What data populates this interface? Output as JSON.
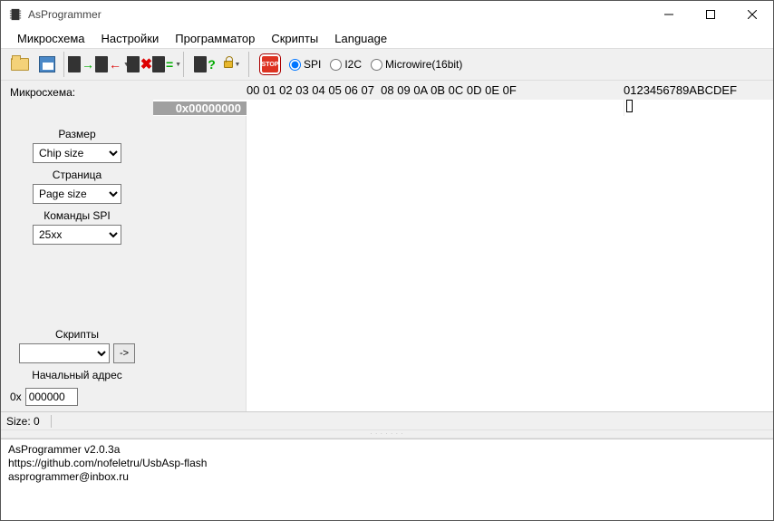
{
  "window": {
    "title": "AsProgrammer"
  },
  "menu": {
    "items": [
      "Микросхема",
      "Настройки",
      "Программатор",
      "Скрипты",
      "Language"
    ]
  },
  "toolbar": {
    "radios": {
      "spi": "SPI",
      "i2c": "I2C",
      "microwire": "Microwire(16bit)",
      "selected": "spi"
    },
    "stop_label": "STOP"
  },
  "sidebar": {
    "title": "Микросхема:",
    "size_label": "Размер",
    "size_value": "Chip size",
    "page_label": "Страница",
    "page_value": "Page size",
    "spi_label": "Команды SPI",
    "spi_value": "25xx",
    "scripts_label": "Скрипты",
    "scripts_value": "",
    "run_label": "->",
    "startaddr_label": "Начальный адрес",
    "startaddr_prefix": "0x",
    "startaddr_value": "000000"
  },
  "hex": {
    "header_cols": "00 01 02 03 04 05 06 07  08 09 0A 0B 0C 0D 0E 0F",
    "header_ascii": "0123456789ABCDEF",
    "row0_addr": "0x00000000"
  },
  "status": {
    "size_label": "Size: 0"
  },
  "console": {
    "lines": [
      "AsProgrammer v2.0.3a",
      "https://github.com/nofeletru/UsbAsp-flash",
      "asprogrammer@inbox.ru"
    ]
  }
}
